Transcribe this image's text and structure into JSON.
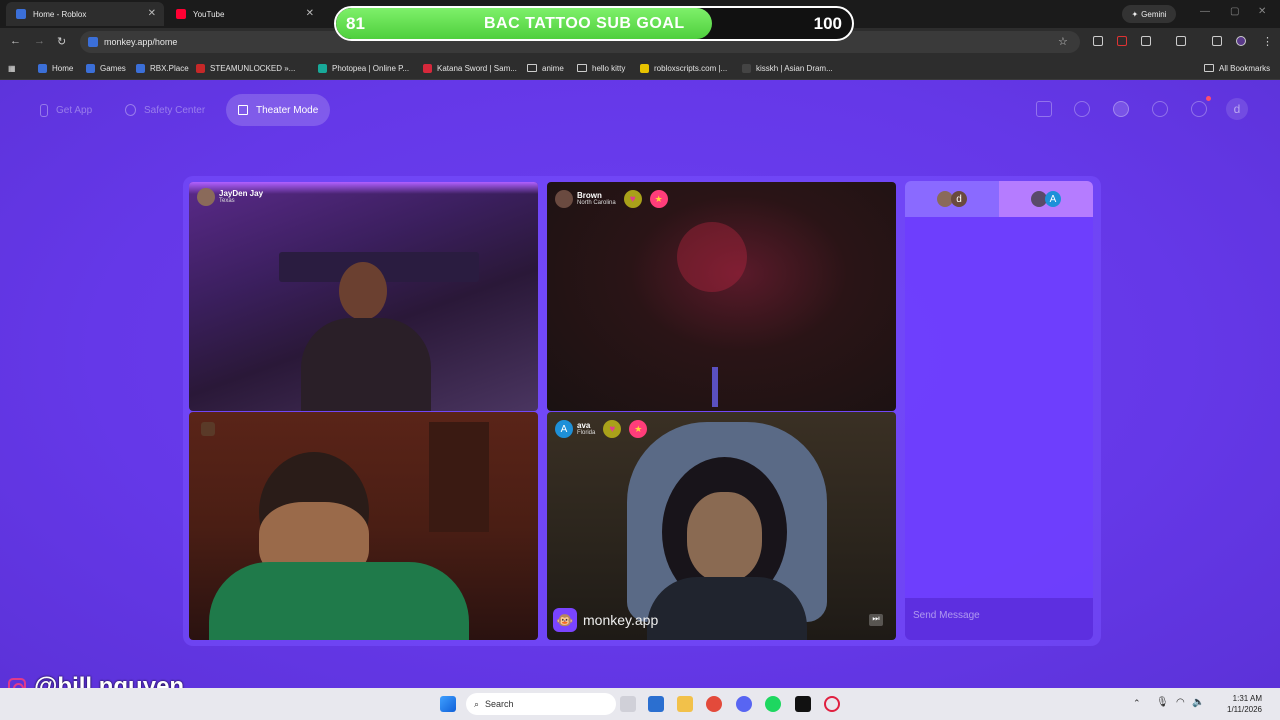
{
  "browser": {
    "tabs": [
      {
        "title": "Home - Roblox",
        "color": "#3b6fd8"
      },
      {
        "title": "YouTube",
        "color": "#ff0033"
      }
    ],
    "gemini_label": "Gemini",
    "url": "monkey.app/home",
    "bookmarks": [
      {
        "label": "Home",
        "color": "#3b6fd8",
        "folder": false
      },
      {
        "label": "Games",
        "color": "#3b6fd8",
        "folder": false
      },
      {
        "label": "RBX.Place",
        "color": "#3b6fd8",
        "folder": false
      },
      {
        "label": "STEAMUNLOCKED »...",
        "color": "#c62828",
        "folder": false
      },
      {
        "label": "Photopea | Online P...",
        "color": "#18a999",
        "folder": false
      },
      {
        "label": "Katana Sword | Sam...",
        "color": "#d6283b",
        "folder": false
      },
      {
        "label": "anime",
        "color": "",
        "folder": true
      },
      {
        "label": "hello kitty",
        "color": "",
        "folder": true
      },
      {
        "label": "robloxscripts.com |...",
        "color": "#e6c200",
        "folder": false
      },
      {
        "label": "kisskh | Asian Dram...",
        "color": "#444444",
        "folder": false
      }
    ],
    "all_bookmarks": "All Bookmarks"
  },
  "goal": {
    "current": "81",
    "title": "BAC TATTOO SUB GOAL",
    "max": "100",
    "progress": 0.81
  },
  "app": {
    "nav": {
      "get_app": "Get App",
      "safety_center": "Safety Center",
      "theater_mode": "Theater Mode"
    },
    "header_avatar_letter": "d",
    "tiles": [
      {
        "name": "JayDen Jay",
        "location": "Texas"
      },
      {
        "name": "Brown",
        "location": "North Carolina"
      },
      {
        "name": "",
        "location": ""
      },
      {
        "name": "ava",
        "location": "Florida",
        "initial": "A"
      }
    ],
    "brand": "monkey.app",
    "chat": {
      "tab1_letter": "d",
      "tab2_letter": "A",
      "placeholder": "Send Message"
    }
  },
  "watermark": "@bill.nguyen",
  "taskbar": {
    "search": "Search",
    "time": "1:31 AM",
    "date": "1/11/2026"
  }
}
